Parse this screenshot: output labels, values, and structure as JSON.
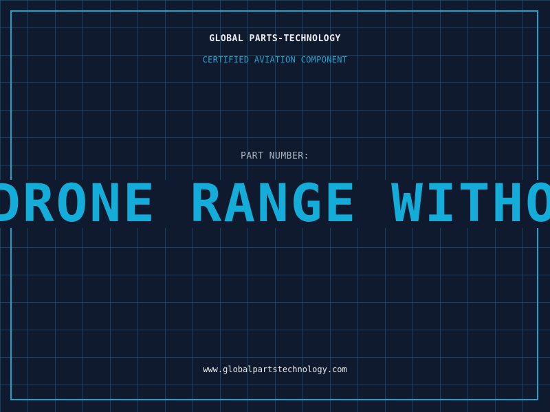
{
  "header": {
    "company_name": "GLOBAL PARTS-TECHNOLOGY",
    "subtitle": "CERTIFIED AVIATION COMPONENT"
  },
  "part": {
    "label": "PART NUMBER:",
    "number_visible": "DRONE RANGE WITHOPU"
  },
  "footer": {
    "website": "www.globalpartstechnology.com"
  },
  "colors": {
    "background": "#101a2e",
    "grid": "#1e7896",
    "accent": "#14acd8",
    "text_light": "#e8ecef",
    "text_muted": "#a9b4c0"
  }
}
